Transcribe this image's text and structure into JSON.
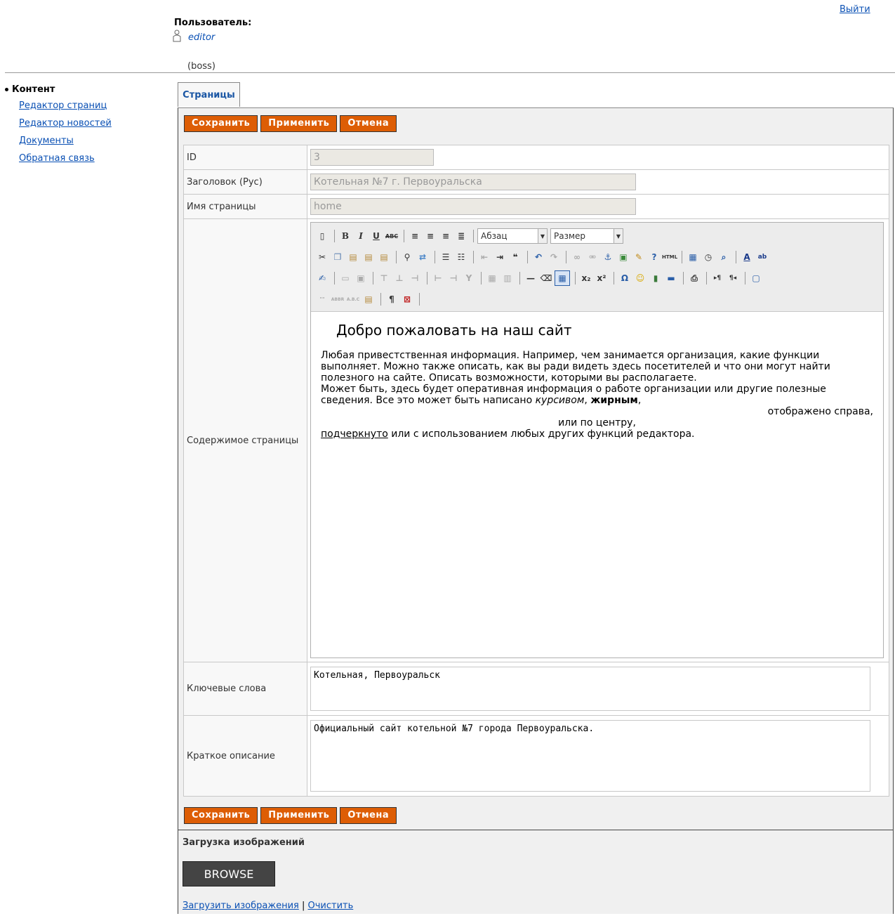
{
  "header": {
    "logout": "Выйти",
    "user_label": "Пользователь:",
    "user_name": "editor",
    "user_role": "(boss)"
  },
  "sidebar": {
    "section": "Контент",
    "items": [
      {
        "label": "Редактор страниц"
      },
      {
        "label": "Редактор новостей"
      },
      {
        "label": "Документы"
      },
      {
        "label": "Обратная связь"
      }
    ]
  },
  "tab": {
    "label": "Страницы"
  },
  "buttons": {
    "save": "Сохранить",
    "apply": "Применить",
    "cancel": "Отмена"
  },
  "form": {
    "id_label": "ID",
    "id_value": "3",
    "title_label": "Заголовок (Рус)",
    "title_value": "Котельная №7 г. Первоуральска",
    "name_label": "Имя страницы",
    "name_value": "home",
    "content_label": "Содержимое страницы",
    "keywords_label": "Ключевые слова",
    "keywords_value": "Котельная, Первоуральск",
    "description_label": "Краткое описание",
    "description_value": "Официальный сайт котельной №7 города Первоуральска."
  },
  "editor": {
    "format_select": "Абзац",
    "size_select": "Размер",
    "heading": "Добро пожаловать на наш сайт",
    "para1": "Любая привестственная информация. Например, чем занимается организация, какие функции выполняет. Можно также описать, как вы ради видеть здесь посетителей и что они могут найти полезного на сайте. Описать возможности, которыми вы располагаете.",
    "para2_start": "Может быть, здесь будет оперативная информация о работе организации или другие полезные сведения. Все это может быть написано ",
    "italic_word": "курсивом",
    "comma1": ", ",
    "bold_word": "жирным",
    "comma2": ",",
    "right_line": "отображено справа,",
    "center_line": "или по центру,",
    "underline_word": "подчеркнуто",
    "last_line": " или с использованием любых других функций редактора."
  },
  "upload": {
    "title": "Загрузка изображений",
    "browse": "BROWSE",
    "upload_link": "Загрузить изображения",
    "divider": " | ",
    "clear_link": "Очистить"
  }
}
